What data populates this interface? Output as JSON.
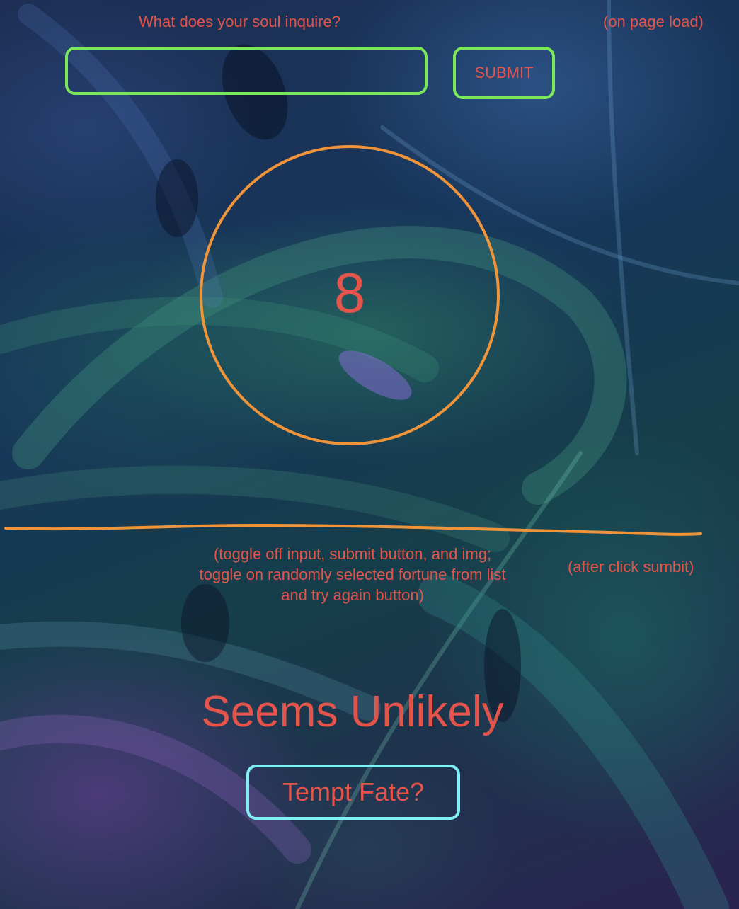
{
  "page_load": {
    "question_label": "What does your soul inquire?",
    "state_note": "(on page load)",
    "input_placeholder": "",
    "submit_label": "SUBMIT",
    "ball_number": "8"
  },
  "after_submit": {
    "instructions": "(toggle off input, submit button, and img; toggle on randomly selected fortune from list and try again button)",
    "state_note": "(after click sumbit)",
    "fortune": "Seems Unlikely",
    "try_again_label": "Tempt Fate?"
  },
  "colors": {
    "annotation_text": "#e5544a",
    "input_outline": "#7be85a",
    "ball_outline": "#f0943a",
    "divider": "#f0943a",
    "try_again_outline": "#7ff0f4"
  }
}
